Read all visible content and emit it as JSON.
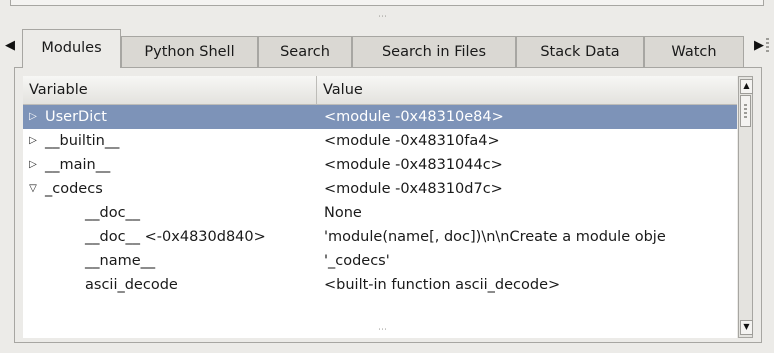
{
  "tabs": [
    {
      "label": "Modules",
      "active": true
    },
    {
      "label": "Python Shell",
      "active": false
    },
    {
      "label": "Search",
      "active": false
    },
    {
      "label": "Search in Files",
      "active": false
    },
    {
      "label": "Stack Data",
      "active": false
    },
    {
      "label": "Watch",
      "active": false
    }
  ],
  "columns": {
    "variable": "Variable",
    "value": "Value"
  },
  "rows": [
    {
      "variable": "UserDict",
      "value": "<module -0x48310e84>",
      "expander": "closed",
      "selected": true
    },
    {
      "variable": "__builtin__",
      "value": "<module -0x48310fa4>",
      "expander": "closed",
      "selected": false
    },
    {
      "variable": "__main__",
      "value": "<module -0x4831044c>",
      "expander": "closed",
      "selected": false
    },
    {
      "variable": "_codecs",
      "value": "<module -0x48310d7c>",
      "expander": "open",
      "selected": false
    },
    {
      "variable": "__doc__",
      "value": "None",
      "expander": "none",
      "selected": false
    },
    {
      "variable": "__doc__ <-0x4830d840>",
      "value": "'module(name[, doc])\\n\\nCreate a module obje",
      "expander": "none",
      "selected": false
    },
    {
      "variable": "__name__",
      "value": "'_codecs'",
      "expander": "none",
      "selected": false
    },
    {
      "variable": "ascii_decode",
      "value": "<built-in function ascii_decode>",
      "expander": "none",
      "selected": false
    }
  ],
  "icons": {
    "tab_scroll_left": "triangle-left-icon",
    "tab_scroll_right": "triangle-right-icon",
    "expander_closed": "triangle-right-icon",
    "expander_open": "triangle-down-icon",
    "scroll_up": "arrow-up-icon",
    "scroll_down": "arrow-down-icon"
  },
  "colors": {
    "selection": "#7d93b8",
    "background": "#ecebe8"
  }
}
